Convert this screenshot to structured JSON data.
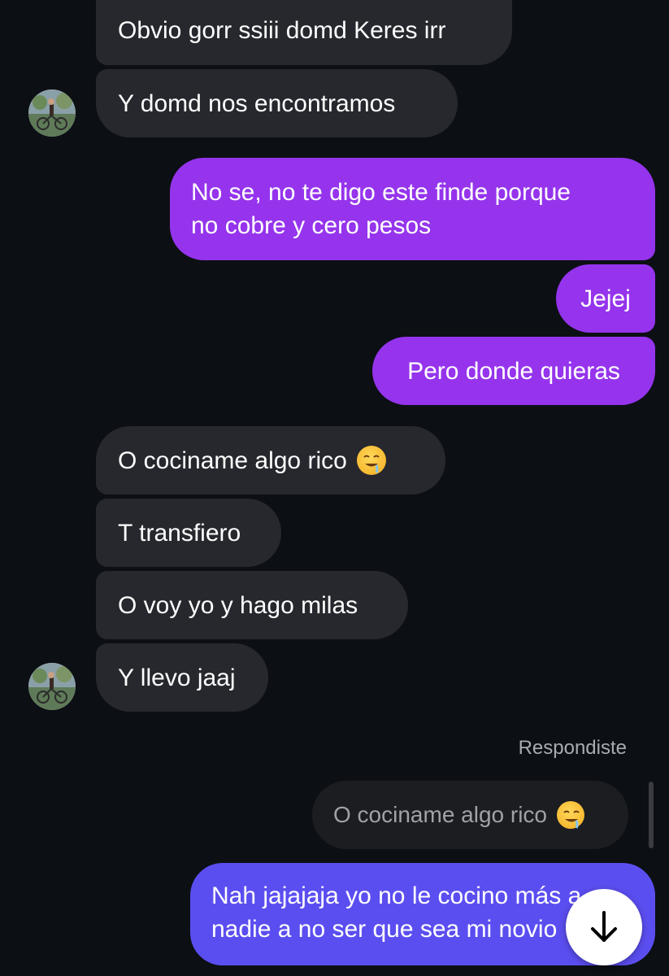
{
  "messages": {
    "m1": "Obvio gorr ssiii domd Keres irr",
    "m2": "Y domd nos encontramos",
    "m3_line1": "No se, no te digo este finde porque",
    "m3_line2": "no cobre y cero pesos",
    "m4": "Jejej",
    "m5": "Pero donde quieras",
    "m6": "O cociname algo rico",
    "m7": "T transfiero",
    "m8": "O voy yo y hago milas",
    "m9": "Y llevo jaaj",
    "reply_label": "Respondiste",
    "quoted": "O cociname algo rico",
    "last_line1": "Nah jajajaja yo no le cocino más a",
    "last_line2": "nadie a no ser que sea mi novio"
  },
  "colors": {
    "background": "#0c0f14",
    "incoming_bubble": "#26282d",
    "outgoing_bubble": "#9534ec",
    "last_outgoing_bubble": "#5b4ef0"
  },
  "icons": {
    "emoji": "drooling-face-emoji",
    "scroll": "arrow-down-icon",
    "avatar": "contact-avatar"
  }
}
